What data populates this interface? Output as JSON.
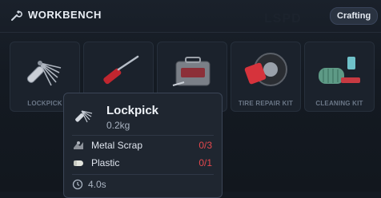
{
  "header": {
    "title": "WORKBENCH",
    "badge": "Crafting",
    "icon": "wrench-icon"
  },
  "recipes": [
    {
      "label": "LOCKPICK",
      "icon": "lockpick-icon"
    },
    {
      "label": "",
      "icon": "screwdriver-icon"
    },
    {
      "label": "",
      "icon": "toolbox-icon"
    },
    {
      "label": "TIRE REPAIR KIT",
      "icon": "tire-repair-kit-icon"
    },
    {
      "label": "CLEANING KIT",
      "icon": "cleaning-kit-icon"
    }
  ],
  "tooltip": {
    "name": "Lockpick",
    "weight": "0.2kg",
    "materials": [
      {
        "name": "Metal Scrap",
        "count": "0/3",
        "icon": "metal-scrap-icon"
      },
      {
        "name": "Plastic",
        "count": "0/1",
        "icon": "plastic-icon"
      }
    ],
    "time": "4.0s",
    "time_icon": "clock-icon"
  },
  "colors": {
    "background": "#141a22",
    "card": "#1b222c",
    "missing": "#e5484d",
    "badge": "#2a3341"
  }
}
